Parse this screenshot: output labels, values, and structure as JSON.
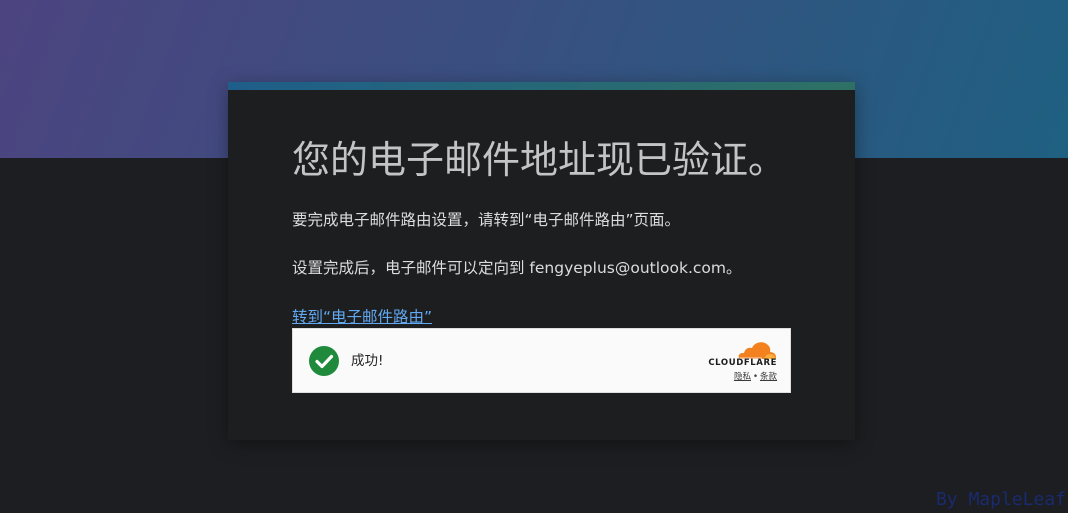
{
  "card": {
    "title": "您的电子邮件地址现已验证。",
    "line1": "要完成电子邮件路由设置，请转到“电子邮件路由”页面。",
    "line2": "设置完成后，电子邮件可以定向到 fengyeplus@outlook.com。",
    "link_label": "转到“电子邮件路由”"
  },
  "turnstile": {
    "status_text": "成功!",
    "status_icon": "check-circle-icon",
    "brand": "CLOUDFLARE",
    "privacy_link": "隐私",
    "separator": "•",
    "terms_link": "条款"
  },
  "watermark": {
    "text": "By MapleLeaf"
  },
  "colors": {
    "hero_gradient_start": "#4c4480",
    "hero_gradient_end": "#1f6081",
    "card_background": "#1c1e20",
    "link": "#62a8f0",
    "success_green": "#1f8a3c",
    "cloudflare_orange": "#f48120",
    "watermark": "#1a2a6e"
  }
}
